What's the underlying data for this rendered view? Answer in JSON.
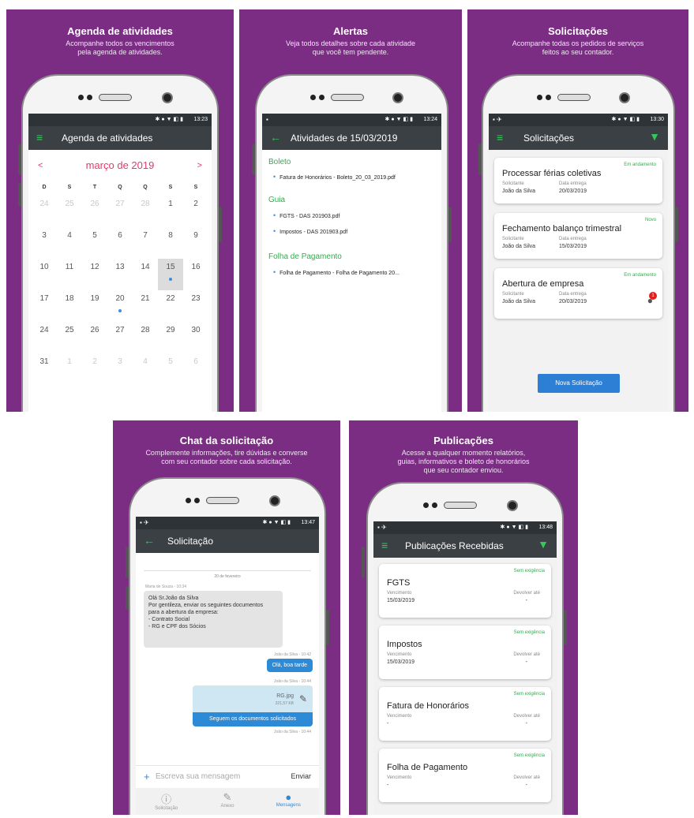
{
  "colors": {
    "panel_bg": "#7b2d83",
    "accent_green": "#2fae4c",
    "accent_red": "#e23b6b",
    "accent_blue": "#2d8ad6",
    "appbar": "#3b4045"
  },
  "panels": {
    "agenda": {
      "title": "Agenda de atividades",
      "subtitle": "Acompanhe todos os vencimentos\npela agenda de atividades.",
      "time": "13:23",
      "appbar_title": "Agenda de atividades",
      "month": "março de 2019",
      "weekdays": [
        "D",
        "S",
        "T",
        "Q",
        "Q",
        "S",
        "S"
      ],
      "weeks": [
        [
          "24",
          "25",
          "26",
          "27",
          "28",
          "1",
          "2"
        ],
        [
          "3",
          "4",
          "5",
          "6",
          "7",
          "8",
          "9"
        ],
        [
          "10",
          "11",
          "12",
          "13",
          "14",
          "15",
          "16"
        ],
        [
          "17",
          "18",
          "19",
          "20",
          "21",
          "22",
          "23"
        ],
        [
          "24",
          "25",
          "26",
          "27",
          "28",
          "29",
          "30"
        ],
        [
          "31",
          "1",
          "2",
          "3",
          "4",
          "5",
          "6"
        ]
      ]
    },
    "alertas": {
      "title": "Alertas",
      "subtitle": "Veja todos detalhes sobre cada atividade\nque você tem pendente.",
      "time": "13:24",
      "appbar_title": "Atividades de 15/03/2019",
      "sections": [
        {
          "name": "Boleto",
          "files": [
            "Fatura de Honorários - Boleto_20_03_2019.pdf"
          ]
        },
        {
          "name": "Guia",
          "files": [
            "FGTS - DAS 201903.pdf",
            "Impostos - DAS 201903.pdf"
          ]
        },
        {
          "name": "Folha de Pagamento",
          "files": [
            "Folha de Pagamento - Folha de Pagamento 20..."
          ]
        }
      ]
    },
    "solicitacoes": {
      "title": "Solicitações",
      "subtitle": "Acompanhe todas os pedidos de serviços\nfeitos ao seu contador.",
      "time": "13:30",
      "appbar_title": "Solicitações",
      "label_requester": "Solicitante",
      "label_date": "Data entrega",
      "cards": [
        {
          "status": "Em andamento",
          "title": "Processar férias coletivas",
          "requester": "João da Silva",
          "date": "20/03/2019"
        },
        {
          "status": "Novo",
          "title": "Fechamento balanço trimestral",
          "requester": "João da Silva",
          "date": "15/03/2019"
        },
        {
          "status": "Em andamento",
          "title": "Abertura de empresa",
          "requester": "João da Silva",
          "date": "20/03/2019",
          "badge": "1"
        }
      ],
      "button": "Nova Solicitação"
    },
    "chat": {
      "title": "Chat da solicitação",
      "subtitle": "Complemente informações, tire dúvidas e converse\ncom seu contador sobre cada solicitação.",
      "time": "13:47",
      "appbar_title": "Solicitação",
      "date_sep": "20 de fevereiro",
      "msg1_meta": "Maria de Souza - 10:34",
      "msg1_text": "Olá Sr.João da Silva\nPor gentileza, enviar os seguintes documentos\npara a abertura da empresa:\n- Contrato Social\n- RG e CPF dos Sócios",
      "msg2_meta": "João da Silva - 10:42",
      "msg2_text": "Olá, boa tarde",
      "msg3_meta": "João da Silva - 10:44",
      "file_name": "RG.jpg",
      "file_size": "321,57 KB",
      "msg3_text": "Seguem os documentos solicitados",
      "msg4_meta": "João da Silva - 10:44",
      "input_placeholder": "Escreva sua mensagem",
      "send": "Enviar",
      "nav": [
        "Solicitação",
        "Anexo",
        "Mensagens"
      ]
    },
    "publicacoes": {
      "title": "Publicações",
      "subtitle": "Acesse a qualquer momento relatórios,\nguias, informativos e boleto de honorários\nque seu contador enviou.",
      "time": "13:48",
      "appbar_title": "Publicações Recebidas",
      "label_due": "Vencimento",
      "label_return": "Devolver até",
      "cards": [
        {
          "status": "Sem exigência",
          "title": "FGTS",
          "due": "15/03/2019",
          "ret": "-"
        },
        {
          "status": "Sem exigência",
          "title": "Impostos",
          "due": "15/03/2019",
          "ret": "-"
        },
        {
          "status": "Sem exigência",
          "title": "Fatura de Honorários",
          "due": "-",
          "ret": "-"
        },
        {
          "status": "Sem exigência",
          "title": "Folha de Pagamento",
          "due": "-",
          "ret": "-"
        }
      ]
    }
  }
}
